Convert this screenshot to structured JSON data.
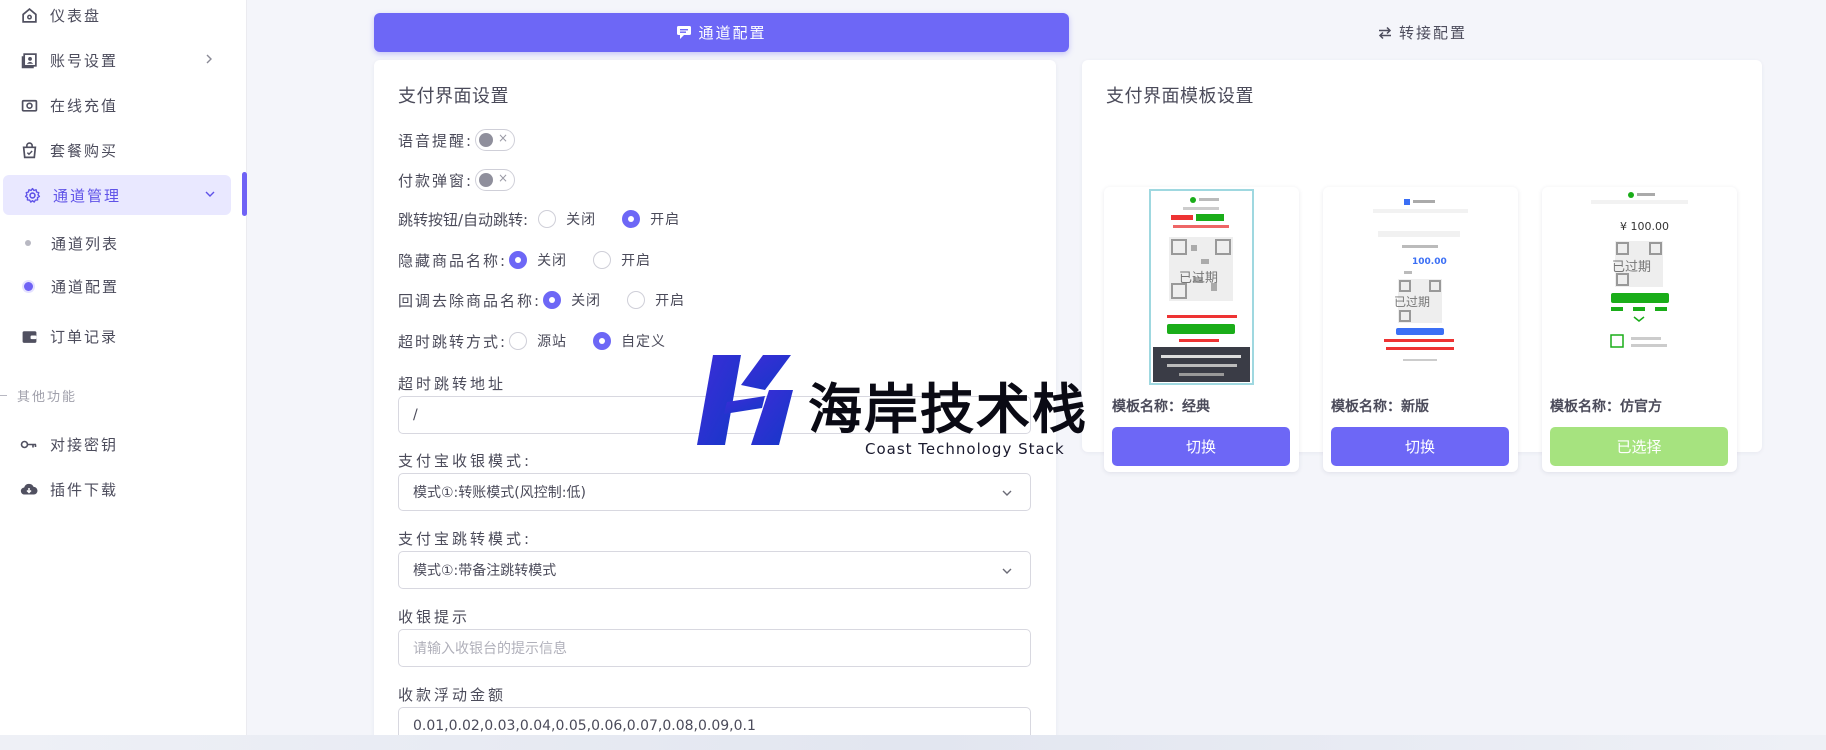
{
  "sidebar": {
    "items": [
      {
        "label": "仪表盘",
        "icon": "home-icon"
      },
      {
        "label": "账号设置",
        "icon": "user-card-icon"
      },
      {
        "label": "在线充值",
        "icon": "camera-icon"
      },
      {
        "label": "套餐购买",
        "icon": "bag-icon"
      },
      {
        "label": "通道管理",
        "icon": "gear-icon"
      },
      {
        "label": "订单记录",
        "icon": "wallet-icon"
      },
      {
        "label": "对接密钥",
        "icon": "key-icon"
      },
      {
        "label": "插件下载",
        "icon": "cloud-download-icon"
      }
    ],
    "sub_items": [
      {
        "label": "通道列表"
      },
      {
        "label": "通道配置"
      }
    ],
    "section_label": "其他功能"
  },
  "tabs": {
    "active": "通道配置",
    "inactive": "转接配置"
  },
  "settings": {
    "title": "支付界面设置",
    "voice_label": "语音提醒:",
    "popup_label": "付款弹窗:",
    "jump_label": "跳转按钮/自动跳转:",
    "hide_name_label": "隐藏商品名称:",
    "callback_label": "回调去除商品名称:",
    "timeout_mode_label": "超时跳转方式:",
    "radio_off": "关闭",
    "radio_on": "开启",
    "radio_origin": "源站",
    "radio_custom": "自定义",
    "timeout_url_label": "超时跳转地址",
    "timeout_url_value": "/",
    "alipay_mode_label": "支付宝收银模式:",
    "alipay_mode_value": "模式①:转账模式(风控制:低)",
    "alipay_jump_label": "支付宝跳转模式:",
    "alipay_jump_value": "模式①:带备注跳转模式",
    "cashier_tip_label": "收银提示",
    "cashier_tip_placeholder": "请输入收银台的提示信息",
    "float_label": "收款浮动金额",
    "float_value": "0.01,0.02,0.03,0.04,0.05,0.06,0.07,0.08,0.09,0.1"
  },
  "templates": {
    "title": "支付界面模板设置",
    "items": [
      {
        "name": "模板名称：经典",
        "button": "切换",
        "selected": false,
        "expired": "已过期"
      },
      {
        "name": "模板名称：新版",
        "button": "切换",
        "selected": false,
        "expired": "已过期",
        "amount": "100.00"
      },
      {
        "name": "模板名称：仿官方",
        "button": "已选择",
        "selected": true,
        "expired": "已过期",
        "amount": "¥ 100.00"
      }
    ]
  },
  "watermark": {
    "text": "海岸技术栈",
    "subtitle": "Coast Technology Stack"
  },
  "colors": {
    "accent": "#6d67f6",
    "selected_green": "#a6e37f",
    "active_bg": "#e9e8ff"
  }
}
